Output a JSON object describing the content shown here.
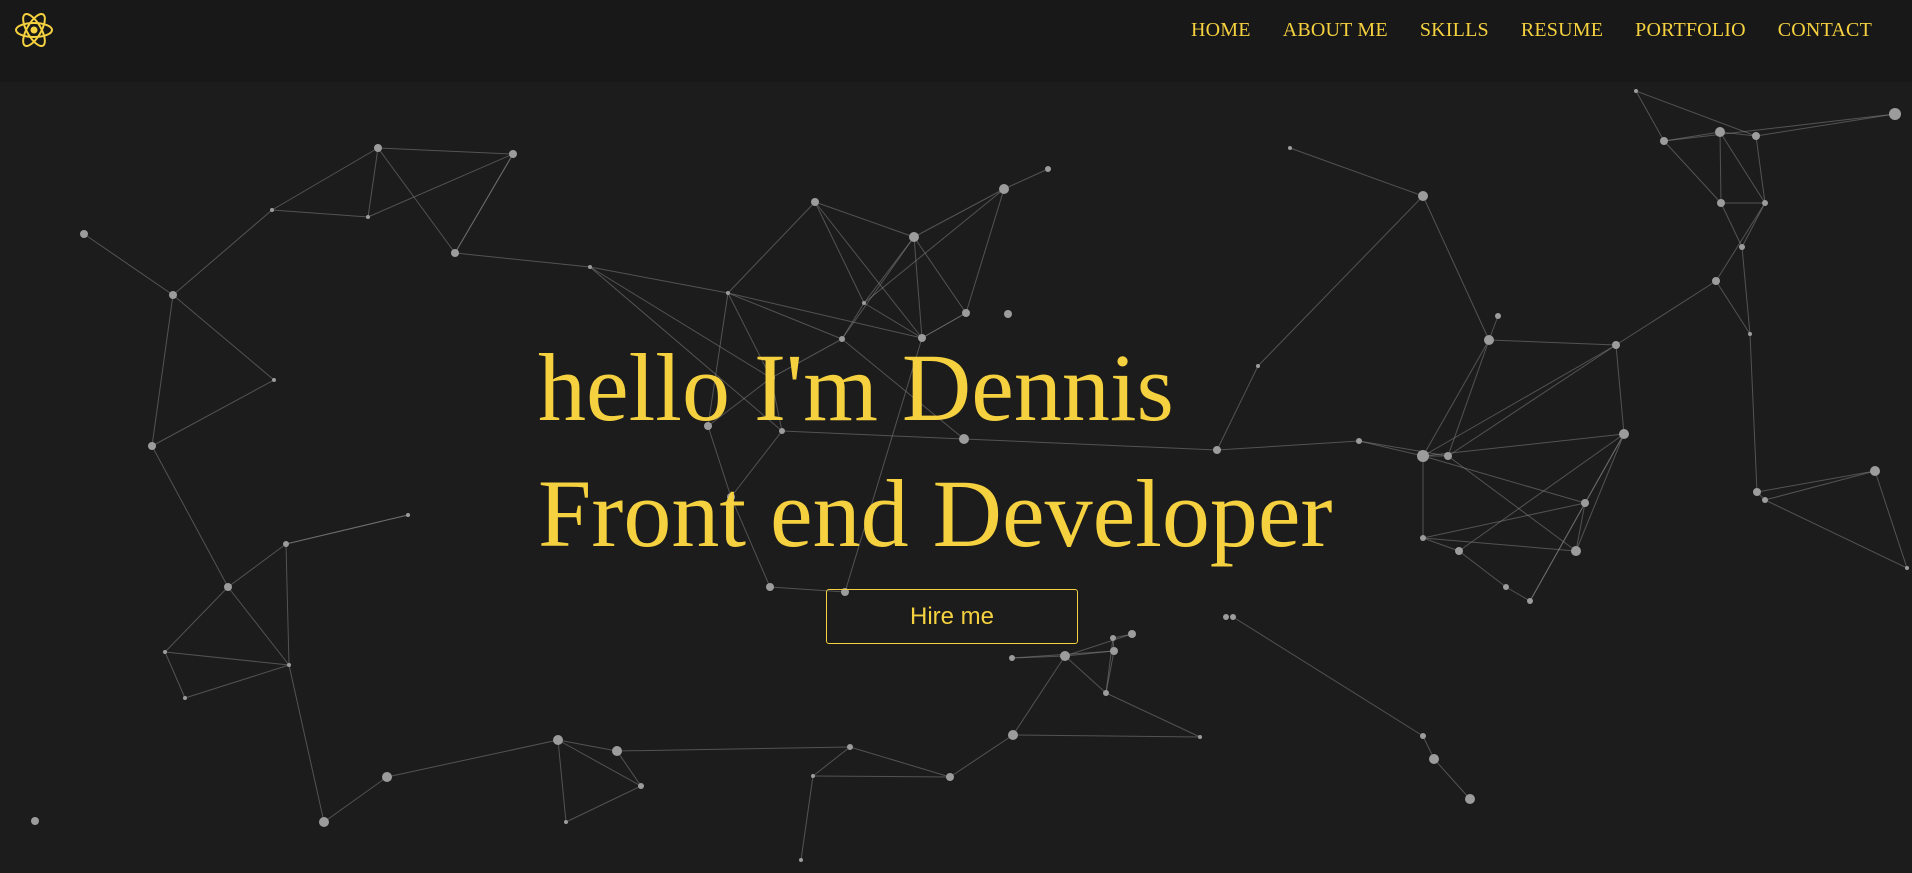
{
  "header": {
    "logo_icon": "react-atom-icon",
    "nav": [
      {
        "label": "HOME"
      },
      {
        "label": "ABOUT ME"
      },
      {
        "label": "SKILLS"
      },
      {
        "label": "RESUME"
      },
      {
        "label": "PORTFOLIO"
      },
      {
        "label": "CONTACT"
      }
    ]
  },
  "hero": {
    "greeting": "hello I'm Dennis",
    "role": "Front end Developer",
    "cta_label": "Hire me"
  },
  "colors": {
    "accent": "#f5d13f",
    "background": "#1c1c1c",
    "navbar": "#181818",
    "particle": "#9c9c9c"
  }
}
